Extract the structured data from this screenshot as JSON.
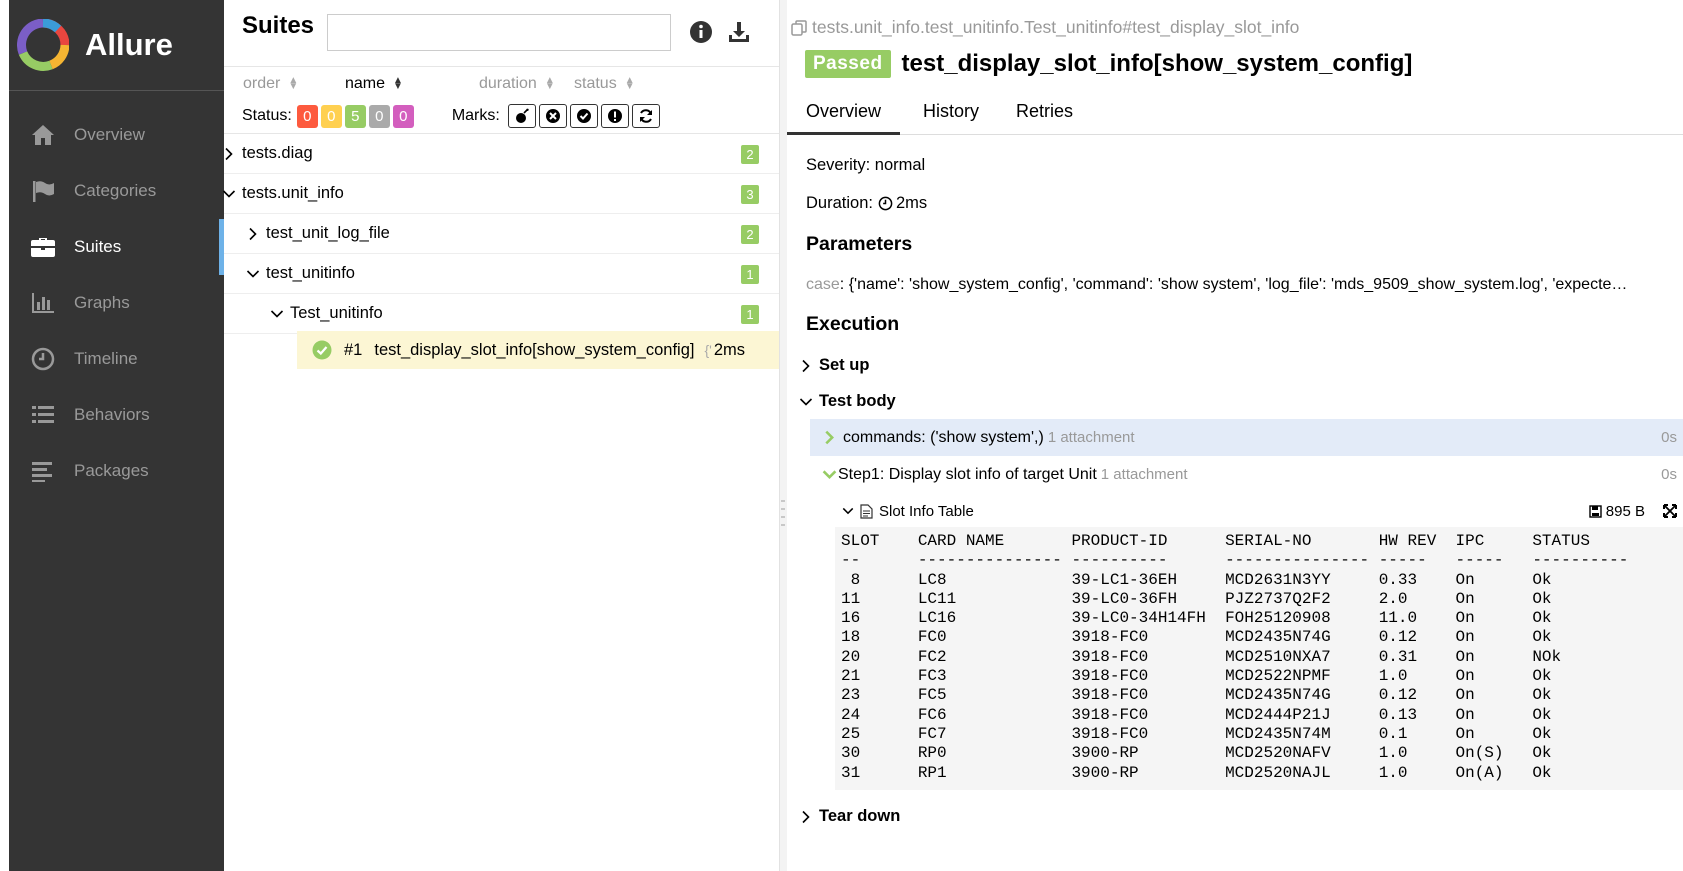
{
  "app": {
    "name": "Allure"
  },
  "sidebar": {
    "items": [
      {
        "label": "Overview",
        "icon": "home-icon",
        "active": false
      },
      {
        "label": "Categories",
        "icon": "flag-icon",
        "active": false
      },
      {
        "label": "Suites",
        "icon": "briefcase-icon",
        "active": true
      },
      {
        "label": "Graphs",
        "icon": "bar-chart-icon",
        "active": false
      },
      {
        "label": "Timeline",
        "icon": "clock-icon",
        "active": false
      },
      {
        "label": "Behaviors",
        "icon": "list-icon",
        "active": false
      },
      {
        "label": "Packages",
        "icon": "align-left-icon",
        "active": false
      }
    ]
  },
  "suites": {
    "title": "Suites",
    "search": {
      "value": "",
      "placeholder": ""
    },
    "sort": {
      "order": "order",
      "name": "name",
      "duration": "duration",
      "status": "status",
      "active": "name"
    },
    "status_label": "Status:",
    "status_counts": [
      {
        "value": "0",
        "color": "#fd5a3e"
      },
      {
        "value": "0",
        "color": "#ffd050"
      },
      {
        "value": "5",
        "color": "#97cc64"
      },
      {
        "value": "0",
        "color": "#aaaaaa"
      },
      {
        "value": "0",
        "color": "#d35ebe"
      }
    ],
    "marks_label": "Marks:",
    "marks": [
      "bomb-icon",
      "close-circle-icon",
      "check-circle-icon",
      "alert-icon",
      "refresh-icon"
    ],
    "tree": [
      {
        "label": "tests.diag",
        "count": "2",
        "expanded": false
      },
      {
        "label": "tests.unit_info",
        "count": "3",
        "expanded": true
      },
      {
        "label": "test_unit_log_file",
        "count": "2",
        "expanded": false
      },
      {
        "label": "test_unitinfo",
        "count": "1",
        "expanded": true
      },
      {
        "label": "Test_unitinfo",
        "count": "1",
        "expanded": true
      }
    ],
    "leaf": {
      "order": "#1",
      "name": "test_display_slot_info[show_system_config]",
      "params_glyph": "{'",
      "duration": "2ms"
    }
  },
  "details": {
    "breadcrumb": "tests.unit_info.test_unitinfo.Test_unitinfo#test_display_slot_info",
    "status": "Passed",
    "status_color": "#97cc64",
    "title": "test_display_slot_info[show_system_config]",
    "tabs": [
      "Overview",
      "History",
      "Retries"
    ],
    "active_tab": "Overview",
    "severity": "Severity: normal",
    "duration_label": "Duration:",
    "duration_value": "2ms",
    "parameters_heading": "Parameters",
    "param_name": "case",
    "param_value": ": {'name': 'show_system_config', 'command': 'show system', 'log_file': 'mds_9509_show_system.log', 'expecte…",
    "execution_heading": "Execution",
    "setup_label": "Set up",
    "test_body_label": "Test body",
    "steps": [
      {
        "label": "commands: ('show system',)",
        "attachments": "1 attachment",
        "duration": "0s"
      },
      {
        "label": "Step1: Display slot info of target Unit",
        "attachments": "1 attachment",
        "duration": "0s"
      }
    ],
    "attachment": {
      "name": "Slot Info Table",
      "size": "895 B"
    },
    "table_header": "SLOT    CARD NAME       PRODUCT-ID      SERIAL-NO       HW REV  IPC     STATUS",
    "table_rule": "--      --------------- ----------      --------------- -----   -----   ----------",
    "table_rows": [
      " 8      LC8             39-LC1-36EH     MCD2631N3YY     0.33    On      Ok",
      "11      LC11            39-LC0-36FH     PJZ2737Q2F2     2.0     On      Ok",
      "16      LC16            39-LC0-34H14FH  FOH25120908     11.0    On      Ok",
      "18      FC0             3918-FC0        MCD2435N74G     0.12    On      Ok",
      "20      FC2             3918-FC0        MCD2510NXA7     0.31    On      NOk",
      "21      FC3             3918-FC0        MCD2522NPMF     1.0     On      Ok",
      "23      FC5             3918-FC0        MCD2435N74G     0.12    On      Ok",
      "24      FC6             3918-FC0        MCD2444P21J     0.13    On      Ok",
      "25      FC7             3918-FC0        MCD2435N74M     0.1     On      Ok",
      "30      RP0             3900-RP         MCD2520NAFV     1.0     On(S)   Ok",
      "31      RP1             3900-RP         MCD2520NAJL     1.0     On(A)   Ok"
    ],
    "teardown_label": "Tear down"
  }
}
